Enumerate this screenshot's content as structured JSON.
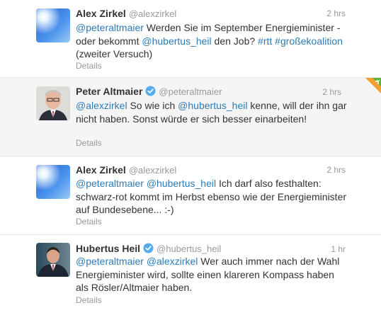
{
  "tweets": [
    {
      "fullname": "Alex Zirkel",
      "username": "@alexzirkel",
      "time": "2 hrs",
      "verified": false,
      "text_parts": [
        {
          "t": "@peteraltmaier",
          "k": "mention"
        },
        {
          "t": " Werden Sie im September Energieminister - oder bekommt ",
          "k": "text"
        },
        {
          "t": "@hubertus_heil",
          "k": "mention"
        },
        {
          "t": " den Job? ",
          "k": "text"
        },
        {
          "t": "#rtt",
          "k": "hashtag"
        },
        {
          "t": " ",
          "k": "text"
        },
        {
          "t": "#großekoalition",
          "k": "hashtag"
        },
        {
          "t": " (zweiter Versuch)",
          "k": "text"
        }
      ],
      "details": "Details",
      "avatar": "sky-sun-avatar"
    },
    {
      "fullname": "Peter Altmaier",
      "username": "@peteraltmaier",
      "time": "2 hrs",
      "verified": true,
      "text_parts": [
        {
          "t": "@alexzirkel",
          "k": "mention"
        },
        {
          "t": " So wie ich ",
          "k": "text"
        },
        {
          "t": "@hubertus_heil",
          "k": "mention"
        },
        {
          "t": " kenne, will der ihn gar nicht haben. Sonst würde er sich besser einarbeiten!",
          "k": "text"
        }
      ],
      "details": "Details",
      "avatar": "portrait-avatar"
    },
    {
      "fullname": "Alex Zirkel",
      "username": "@alexzirkel",
      "time": "2 hrs",
      "verified": false,
      "text_parts": [
        {
          "t": "@peteraltmaier",
          "k": "mention"
        },
        {
          "t": " ",
          "k": "text"
        },
        {
          "t": "@hubertus_heil",
          "k": "mention"
        },
        {
          "t": " Ich darf also festhalten: schwarz-rot kommt im Herbst ebenso wie der Energieminister auf Bundesebene... :-)",
          "k": "text"
        }
      ],
      "details": "Details",
      "avatar": "sky-sun-avatar"
    },
    {
      "fullname": "Hubertus Heil",
      "username": "@hubertus_heil",
      "time": "1 hr",
      "verified": true,
      "text_parts": [
        {
          "t": "@peteraltmaier",
          "k": "mention"
        },
        {
          "t": " ",
          "k": "text"
        },
        {
          "t": "@alexzirkel",
          "k": "mention"
        },
        {
          "t": " Wer auch immer nach der Wahl Energieminister wird, sollte einen klareren Kompass haben als Rösler/Altmaier haben.",
          "k": "text"
        }
      ],
      "details": "Details",
      "avatar": "portrait-avatar"
    }
  ],
  "colors": {
    "link": "#2b7bb9",
    "meta": "#999999",
    "verified": "#55acee",
    "highlight_bg": "#f5f5f5"
  }
}
